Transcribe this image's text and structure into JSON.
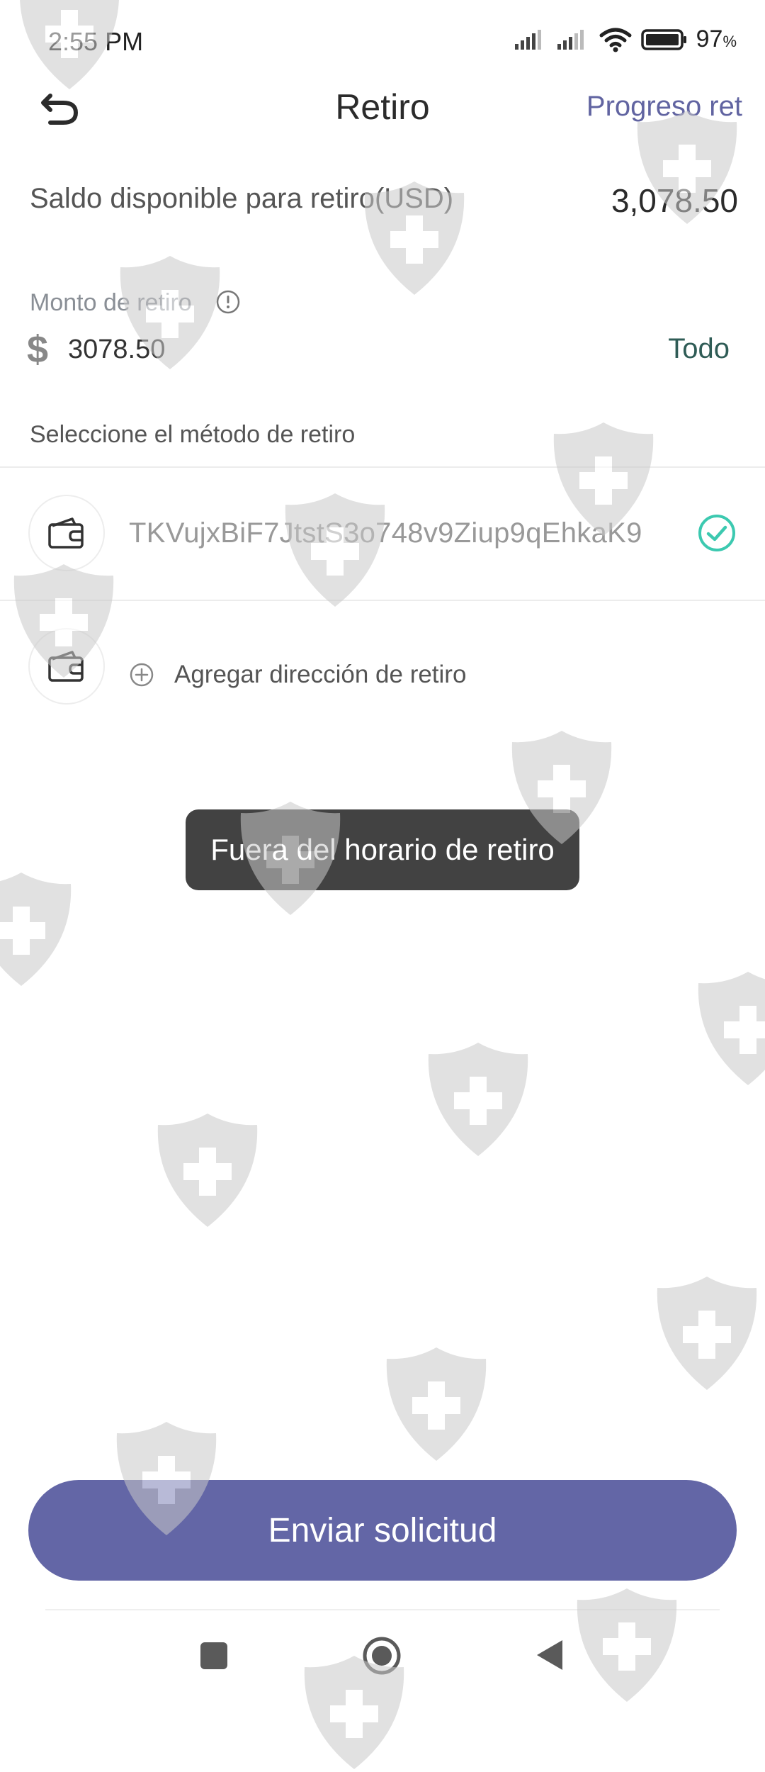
{
  "status_bar": {
    "time": "2:55 PM",
    "battery": "97",
    "battery_unit": "%"
  },
  "header": {
    "back_icon": "undo-arrow-icon",
    "title": "Retiro",
    "progress_link": "Progreso ret"
  },
  "balance": {
    "label": "Saldo disponible para retiro(USD)",
    "value": "3,078.50"
  },
  "amount": {
    "label": "Monto de retiro",
    "currency_symbol": "$",
    "value": "3078.50",
    "all_label": "Todo"
  },
  "method": {
    "label": "Seleccione el método de retiro",
    "address": "TKVujxBiF7JtstS3o748v9Ziup9qEhkaK9",
    "selected": true,
    "add_label": "Agregar dirección de retiro"
  },
  "toast": {
    "message": "Fuera del horario de retiro"
  },
  "submit": {
    "label": "Enviar solicitud"
  },
  "colors": {
    "accent": "#6366a6",
    "check": "#3cc9b0",
    "toast_bg": "#424242"
  }
}
